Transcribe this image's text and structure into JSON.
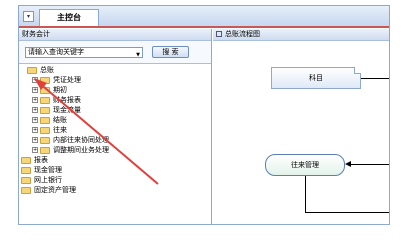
{
  "tab": {
    "label": "主控台"
  },
  "left_panel": {
    "title": "财务会计",
    "search": {
      "placeholder": "请输入查询关键字",
      "button": "搜 索"
    },
    "tree": {
      "root": "总账",
      "children": [
        "凭证处理",
        "期初",
        "财务报表",
        "现金流量",
        "结账",
        "往来",
        "内部往来协同处理",
        "调整期间业务处理"
      ],
      "siblings": [
        "报表",
        "现金管理",
        "网上银行",
        "固定资产管理"
      ]
    }
  },
  "right_panel": {
    "title": "总账流程图",
    "nodes": {
      "subject": "科目",
      "contacts": "往来管理"
    }
  },
  "colors": {
    "arrow": "#e0403a",
    "tab_accent": "#cc5555",
    "border": "#8ea9cf"
  }
}
